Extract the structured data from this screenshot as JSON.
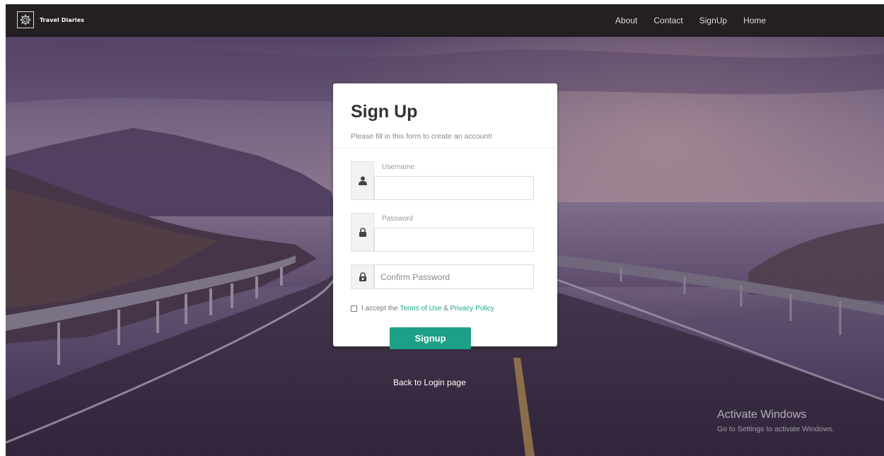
{
  "navbar": {
    "brand": "Travel Diaries",
    "links": [
      "About",
      "Contact",
      "SignUp",
      "Home"
    ]
  },
  "form": {
    "title": "Sign Up",
    "subtitle": "Please fill in this form to create an account!",
    "username_label": "Username",
    "username_value": "",
    "password_label": "Password",
    "password_value": "",
    "confirm_placeholder": "Confirm Password",
    "accept_prefix": "I accept the ",
    "terms_link": "Terms of Use",
    "amp": " & ",
    "privacy_link": "Privacy Policy",
    "submit_label": "Signup"
  },
  "back_link": "Back to Login page",
  "windows": {
    "title": "Activate Windows",
    "subtitle": "Go to Settings to activate Windows."
  },
  "colors": {
    "accent": "#1ea086",
    "navbar": "#231f22",
    "link": "#1ba88a"
  },
  "icons": {
    "logo": "gear-logo-icon",
    "username": "user-icon",
    "password": "lock-icon",
    "confirm": "lock-check-icon"
  }
}
